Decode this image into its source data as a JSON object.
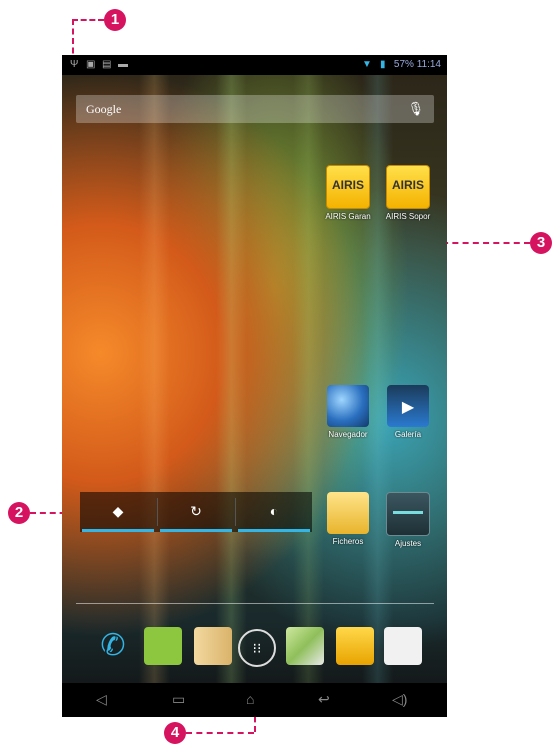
{
  "callouts": [
    "1",
    "2",
    "3",
    "4"
  ],
  "status_bar": {
    "left_icons": [
      "usb-icon",
      "android-debug-icon",
      "notification-icon",
      "battery-small-icon"
    ],
    "battery_percent": "57%",
    "time": "11:14"
  },
  "search": {
    "label": "Google",
    "mic_icon": "mic-icon"
  },
  "apps": [
    {
      "label": "AIRIS Garan",
      "icon_text": "AIRIS",
      "icon": "airis-warranty-icon"
    },
    {
      "label": "AIRIS Sopor",
      "icon_text": "AIRIS",
      "icon": "airis-support-icon"
    },
    {
      "label": "Navegador",
      "icon": "browser-globe-icon"
    },
    {
      "label": "Galería",
      "icon": "gallery-video-icon"
    },
    {
      "label": "Ficheros",
      "icon": "files-folder-icon"
    },
    {
      "label": "Ajustes",
      "icon": "settings-icon"
    }
  ],
  "widget": {
    "buttons": [
      "wifi-icon",
      "sync-icon",
      "brightness-icon"
    ]
  },
  "dock": [
    "phone-icon",
    "messaging-icon",
    "contacts-icon",
    "all-apps-icon",
    "maps-icon",
    "email-icon",
    "play-store-icon"
  ],
  "nav": [
    "volume-down-icon",
    "recent-apps-icon",
    "home-icon",
    "back-icon",
    "volume-up-icon"
  ],
  "colors": {
    "accent": "#33b5e5",
    "callout": "#d6135f"
  }
}
